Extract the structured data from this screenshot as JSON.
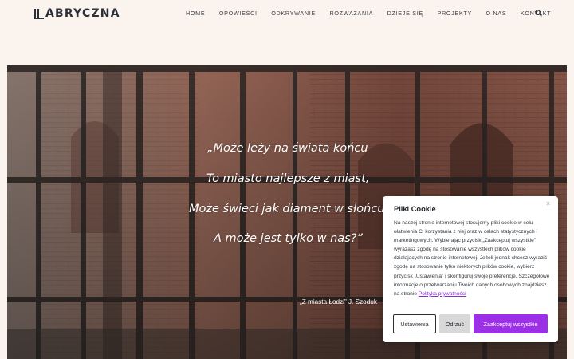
{
  "header": {
    "logo_text": "ABRYCZNA",
    "nav": [
      "HOME",
      "OPOWIEŚCI",
      "ODKRYWANIE",
      "ROZWAŻANIA",
      "DZIEJE SIĘ",
      "PROJEKTY",
      "O NAS",
      "KONTAKT"
    ]
  },
  "hero": {
    "lines": [
      "„Może leży na świata końcu",
      "To miasto najlepsze z miast,",
      "Może świeci jak diament w słońcu,",
      "A może jest tylko w nas?”"
    ],
    "source": "„Z miasta Łodzi” J. Szoduk"
  },
  "cookie": {
    "title": "Pliki Cookie",
    "close": "×",
    "text": "Na naszej stronie internetowej stosujemy pliki cookie w celu ułatwienia Ci korzystania z niej oraz w celach statystycznych i marketingowych. Wybierając przycisk „Zaakceptuj wszystkie” wyrażasz zgodę na stosowanie wszystkich plików cookie działających na stronie internetowej. Jeżeli jednak chcesz wyrazić zgodę na stosowanie tylko niektórych plików cookie, wybierz przycisk „Ustawienia” i skonfiguruj swoje preferencje. Szczegółowe informacje o przetwarzaniu Twoich danych osobowych znajdziesz na stronie",
    "link": "Polityka prywatności",
    "btn_settings": "Ustawienia",
    "btn_reject": "Odrzuć",
    "btn_accept": "Zaakceptuj wszystkie"
  },
  "colors": {
    "background": "#fbf4ee",
    "accent": "#9b30e6",
    "dark": "#2a2f38"
  }
}
